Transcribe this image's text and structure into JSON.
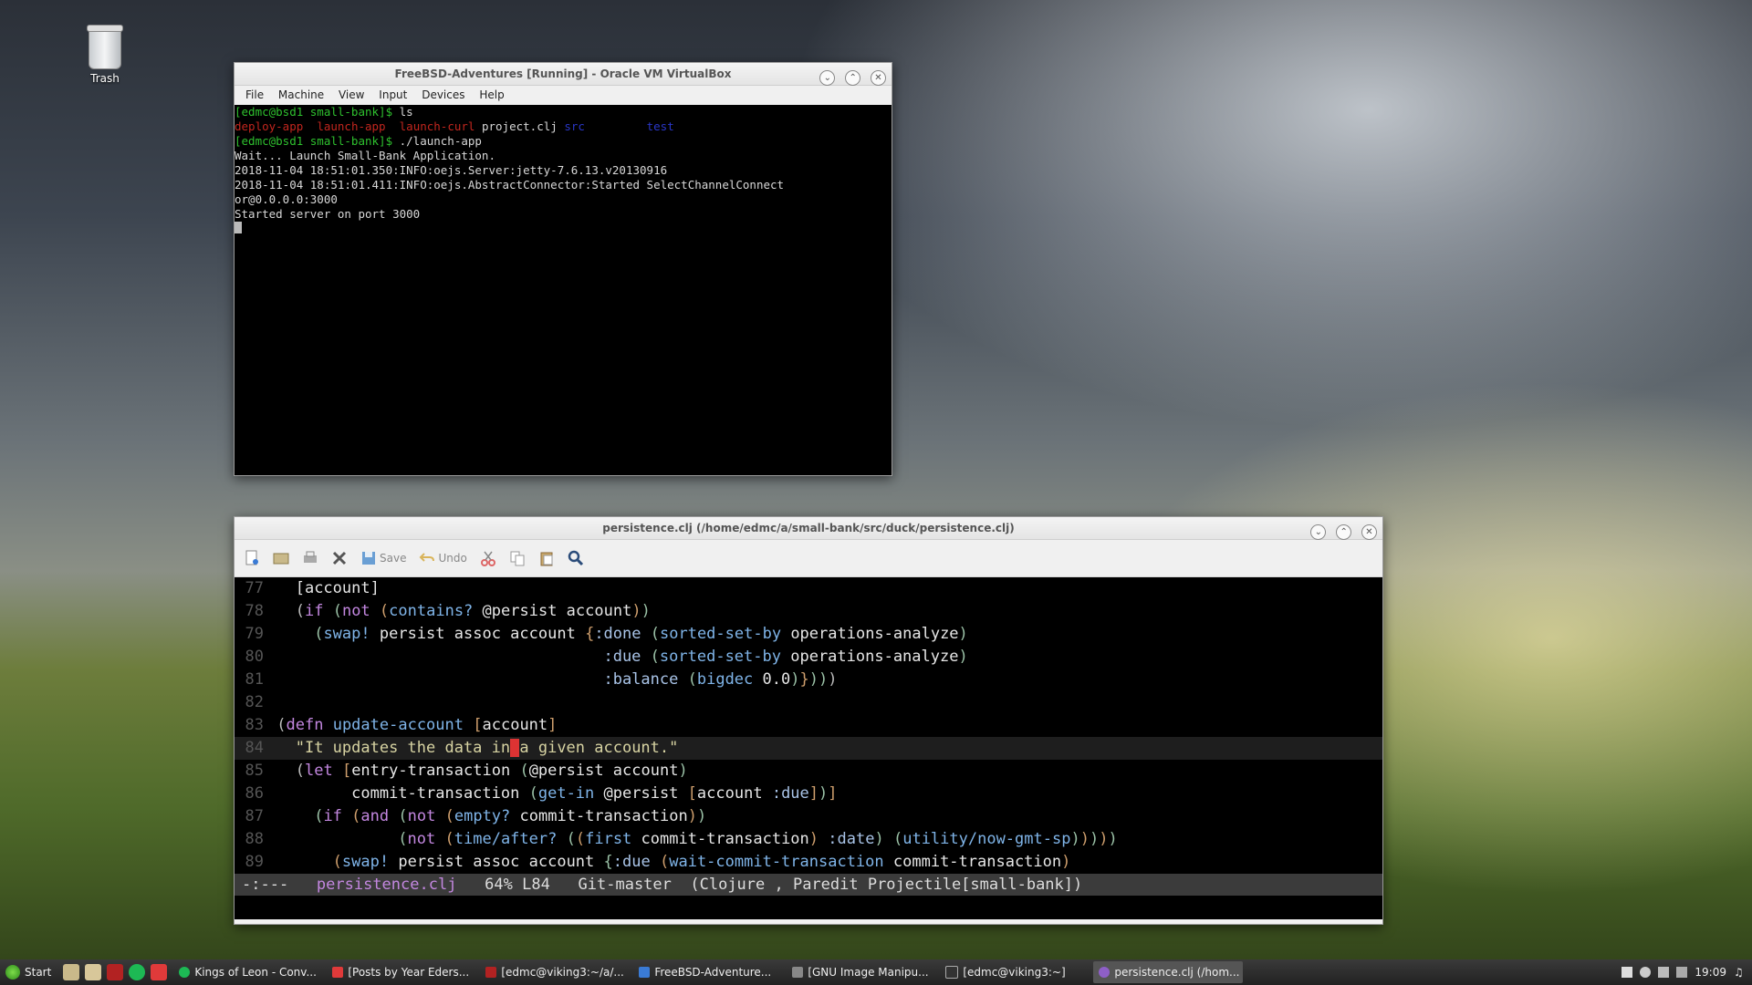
{
  "desktop": {
    "trash_label": "Trash"
  },
  "vbox": {
    "title": "FreeBSD-Adventures [Running] - Oracle VM VirtualBox",
    "menu": [
      "File",
      "Machine",
      "View",
      "Input",
      "Devices",
      "Help"
    ],
    "terminal": {
      "line1_prompt": "[edmc@bsd1 small-bank]$",
      "line1_cmd": " ls",
      "ls_deploy": "deploy-app",
      "ls_launch": "launch-app",
      "ls_curl": "launch-curl",
      "ls_project": "project.clj",
      "ls_src": "src",
      "ls_test": "test",
      "line3_prompt": "[edmc@bsd1 small-bank]$",
      "line3_cmd": " ./launch-app",
      "line4": "Wait... Launch Small-Bank Application.",
      "line5": "2018-11-04 18:51:01.350:INFO:oejs.Server:jetty-7.6.13.v20130916",
      "line6": "2018-11-04 18:51:01.411:INFO:oejs.AbstractConnector:Started SelectChannelConnect",
      "line7": "or@0.0.0.0:3000",
      "line8": "Started server on port 3000"
    }
  },
  "editor": {
    "title": "persistence.clj (/home/edmc/a/small-bank/src/duck/persistence.clj)",
    "toolbar": {
      "save_label": "Save",
      "undo_label": "Undo"
    },
    "line_numbers": [
      "77",
      "78",
      "79",
      "80",
      "81",
      "82",
      "83",
      "84",
      "85",
      "86",
      "87",
      "88",
      "89"
    ],
    "code": {
      "l77": "[account]",
      "l83_name": "update-account",
      "l84_docstring_a": "\"It updates the data in",
      "l84_caret": " ",
      "l84_docstring_b": "a given account.\""
    },
    "modeline": {
      "status": "-:---",
      "filename": "persistence.clj",
      "position": "64% L84",
      "vc": "Git-master",
      "modes": "(Clojure , Paredit Projectile[small-bank])"
    }
  },
  "taskbar": {
    "start_label": "Start",
    "tasks": [
      "Kings of Leon - Conv...",
      "[Posts by Year Eders...",
      "[edmc@viking3:~/a/...",
      "FreeBSD-Adventure...",
      "[GNU Image Manipu...",
      "[edmc@viking3:~]",
      "persistence.clj (/hom..."
    ],
    "clock": "19:09"
  }
}
